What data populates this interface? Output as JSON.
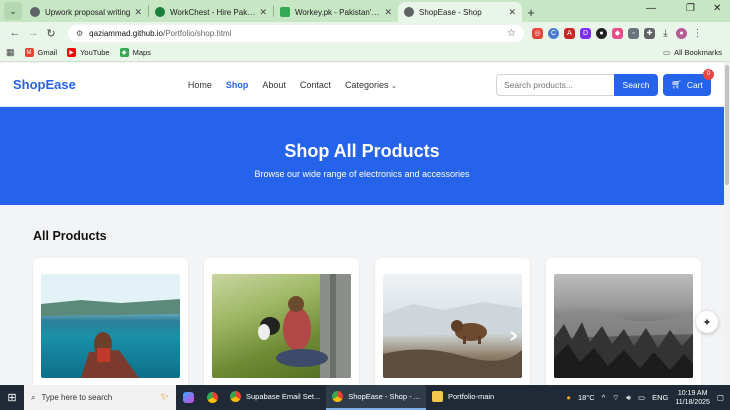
{
  "browser": {
    "tabs": [
      {
        "title": "Upwork proposal writing",
        "favicon_color": "#5f6368",
        "active": false
      },
      {
        "title": "WorkChest - Hire Pakistani Free",
        "favicon_color": "#188038",
        "active": false
      },
      {
        "title": "Workey.pk - Pakistan's Freelan",
        "favicon_color": "#34a853",
        "active": false
      },
      {
        "title": "ShopEase - Shop",
        "favicon_color": "#5f6368",
        "active": true
      }
    ],
    "url_host": "qaziammad.github.io",
    "url_path": "/Portfolio/shop.html",
    "bookmarks": [
      {
        "label": "Gmail",
        "icon": "gmail-icon",
        "color": "#ea4335"
      },
      {
        "label": "YouTube",
        "icon": "youtube-icon",
        "color": "#ff0000"
      },
      {
        "label": "Maps",
        "icon": "maps-icon",
        "color": "#34a853"
      }
    ],
    "all_bookmarks_label": "All Bookmarks"
  },
  "site": {
    "logo": "ShopEase",
    "nav": [
      {
        "label": "Home",
        "active": false
      },
      {
        "label": "Shop",
        "active": true
      },
      {
        "label": "About",
        "active": false
      },
      {
        "label": "Contact",
        "active": false
      },
      {
        "label": "Categories",
        "active": false
      }
    ],
    "search_placeholder": "Search products...",
    "search_button": "Search",
    "cart_label": "Cart",
    "cart_count": "0",
    "accent_color": "#2563eb"
  },
  "hero": {
    "title": "Shop All Products",
    "subtitle": "Browse our wide range of electronics and accessories"
  },
  "products_section": {
    "title": "All Products",
    "items": [
      {
        "image": "lake-canoe-photo"
      },
      {
        "image": "field-dog-photo"
      },
      {
        "image": "bear-photo"
      },
      {
        "image": "misty-forest-photo"
      }
    ]
  },
  "taskbar": {
    "search_placeholder": "Type here to search",
    "apps": [
      {
        "label": "Supabase Email Set...",
        "active": false
      },
      {
        "label": "ShopEase - Shop - ...",
        "active": true
      },
      {
        "label": "Portfolio-main",
        "active": false
      }
    ],
    "weather": "18°C",
    "language": "ENG",
    "time": "10:19 AM",
    "date": "11/18/2025"
  }
}
